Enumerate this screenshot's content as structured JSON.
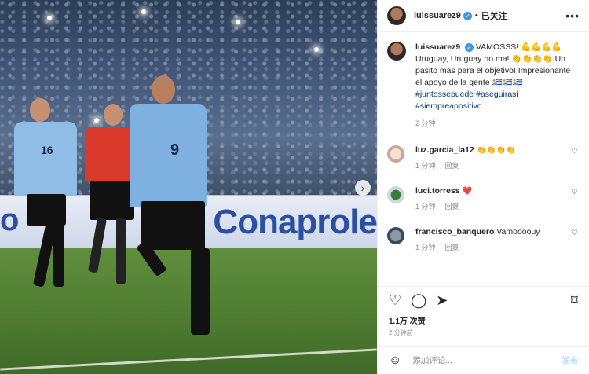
{
  "header": {
    "username": "luissuarez9",
    "verified_mark": "✓",
    "separator": "•",
    "follow_status": "已关注",
    "more": "•••"
  },
  "caption": {
    "username": "luissuarez9",
    "text": "VAMOSSS! 💪💪💪💪 Uruguay, Uruguay no ma! 👏👏👏👏 Un pasito mas para el objetivo! Impresionante el apoyo de la gente 🇺🇾🇺🇾🇺🇾 ",
    "hashtags": "#juntossepuede #aseguirasi #siempreapositivo",
    "time": "2 分钟"
  },
  "comments": [
    {
      "user": "luz.garcia_la12",
      "text": "👏👏👏👏",
      "time": "1 分钟",
      "reply": "回复"
    },
    {
      "user": "luci.torress",
      "text": "❤️",
      "time": "1 分钟",
      "reply": "回复"
    },
    {
      "user": "francisco_banquero",
      "text": "Vamoooouy",
      "time": "1 分钟",
      "reply": "回复"
    }
  ],
  "likes": "1.1万 次赞",
  "posted": "2 分钟前",
  "add_comment": {
    "placeholder": "添加评论...",
    "post": "发布"
  },
  "photo": {
    "ad_text": "Conaprole",
    "ad_text_left": "o",
    "shirt_number": "9",
    "teammate_number": "16"
  },
  "icons": [
    "heart-icon",
    "comment-icon",
    "share-icon",
    "bookmark-icon",
    "smile-icon",
    "next-arrow-icon",
    "more-icon"
  ],
  "colors": {
    "accent": "#3897f0",
    "hashtag": "#00376b",
    "uruguay_blue": "#7fb1e0",
    "referee_red": "#d93a2b"
  }
}
